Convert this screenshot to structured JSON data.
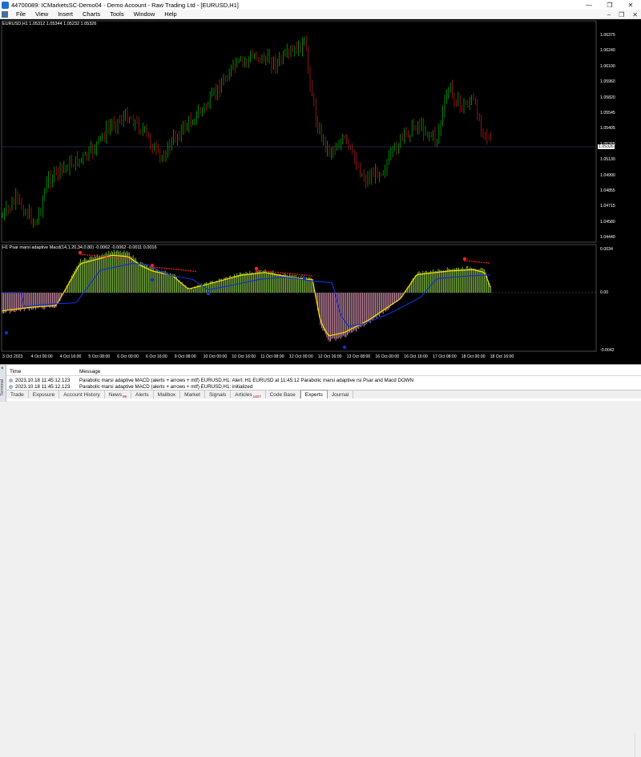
{
  "window": {
    "title": "44700089: ICMarketsSC-Demo04 - Demo Account - Raw Trading Ltd - [EURUSD,H1]",
    "minimize": "—",
    "restore": "❐",
    "close": "✕"
  },
  "menu": {
    "items": [
      "File",
      "View",
      "Insert",
      "Charts",
      "Tools",
      "Window",
      "Help"
    ],
    "right_min": "–",
    "right_restore": "❐",
    "right_close": "✕"
  },
  "chart": {
    "header": "EURUSD,H1  1.05312 1.05344 1.05232 1.05326",
    "current_price": "1.05326",
    "price_ticks": [
      "1.06375",
      "1.06240",
      "1.06100",
      "1.05960",
      "1.05820",
      "1.05545",
      "1.05405",
      "1.05265",
      "1.05130",
      "1.04990",
      "1.04855",
      "1.04715",
      "1.04580",
      "1.04440"
    ],
    "indicator_header": "H1 Psar marsi adaptive Macd(14,1.20,34,0.80)  -0.0062 -0.0062 -0.0011 0.0016",
    "indicator_ticks": [
      "0.0034",
      "0.00",
      "-0.0042"
    ],
    "time_ticks": [
      "3 Oct 2023",
      "4 Oct 00:00",
      "4 Oct 16:00",
      "5 Oct 08:00",
      "6 Oct 00:00",
      "6 Oct 16:00",
      "9 Oct 08:00",
      "10 Oct 00:00",
      "10 Oct 16:00",
      "11 Oct 08:00",
      "12 Oct 00:00",
      "12 Oct 16:00",
      "13 Oct 08:00",
      "16 Oct 00:00",
      "16 Oct 16:00",
      "17 Oct 08:00",
      "18 Oct 00:00",
      "18 Oct 16:00"
    ],
    "colors": {
      "background": "#000000",
      "bull": "#00c000",
      "bear": "#c02020",
      "hist_pos": "#8fd14f",
      "hist_neg": "#e8a0c0",
      "signal": "#ffe000",
      "fast": "#1030d0",
      "dots": "#ff2020"
    }
  },
  "terminal": {
    "col_time": "Time",
    "col_message": "Message",
    "rows": [
      {
        "time": "2023.10.18 11:45:12.123",
        "message": "Parabolic marsi adaptive MACD (alerts + arrows + mtf) EURUSD,H1: Alert: H1 EURUSD at 11:45:12 Parabolic marsi adaptive rsi Psar and Macd DOWN"
      },
      {
        "time": "2023.10.18 11:45:12.123",
        "message": "Parabolic marsi adaptive MACD (alerts + arrows + mtf) EURUSD,H1: initialized"
      }
    ],
    "side_label": "Terminal",
    "close": "×",
    "tabs": [
      {
        "label": "Trade",
        "badge": ""
      },
      {
        "label": "Exposure",
        "badge": ""
      },
      {
        "label": "Account History",
        "badge": ""
      },
      {
        "label": "News",
        "badge": "99"
      },
      {
        "label": "Alerts",
        "badge": ""
      },
      {
        "label": "Mailbox",
        "badge": ""
      },
      {
        "label": "Market",
        "badge": ""
      },
      {
        "label": "Signals",
        "badge": ""
      },
      {
        "label": "Articles",
        "badge": "1407"
      },
      {
        "label": "Code Base",
        "badge": ""
      },
      {
        "label": "Experts",
        "badge": ""
      },
      {
        "label": "Journal",
        "badge": ""
      }
    ],
    "active_tab": "Experts"
  }
}
